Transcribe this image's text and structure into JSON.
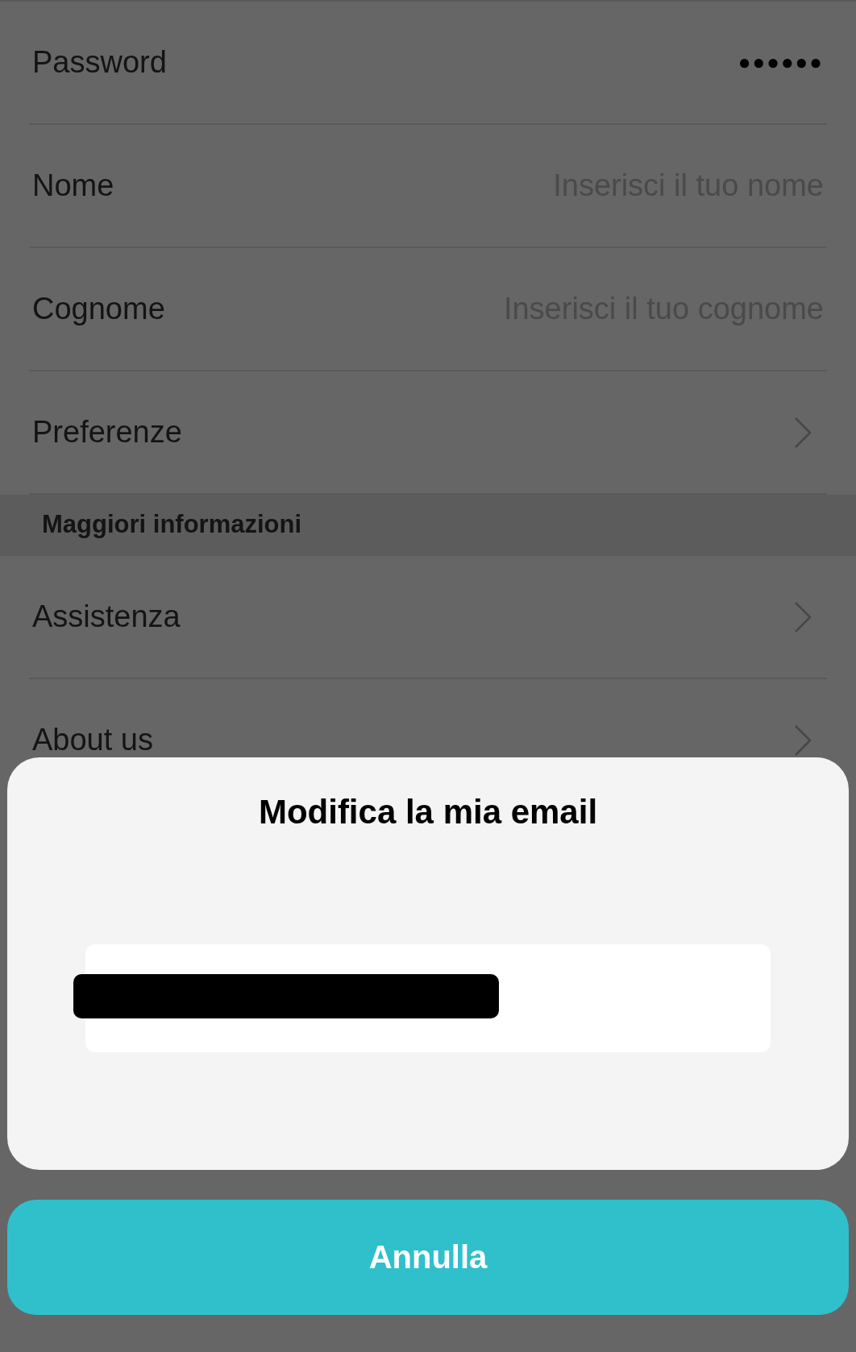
{
  "settings_rows": [
    {
      "label": "Password",
      "kind": "secret",
      "value": "●●●●●●"
    },
    {
      "label": "Nome",
      "kind": "input",
      "placeholder": "Inserisci il tuo nome"
    },
    {
      "label": "Cognome",
      "kind": "input",
      "placeholder": "Inserisci il tuo cognome"
    },
    {
      "label": "Preferenze",
      "kind": "link"
    }
  ],
  "section": {
    "title": "Maggiori informazioni",
    "rows": [
      {
        "label": "Assistenza",
        "kind": "link"
      },
      {
        "label": "About us",
        "kind": "link"
      }
    ]
  },
  "dialog": {
    "title": "Modifica la mia email",
    "email_field": {
      "redacted": true
    }
  },
  "cancel_button": "Annulla"
}
